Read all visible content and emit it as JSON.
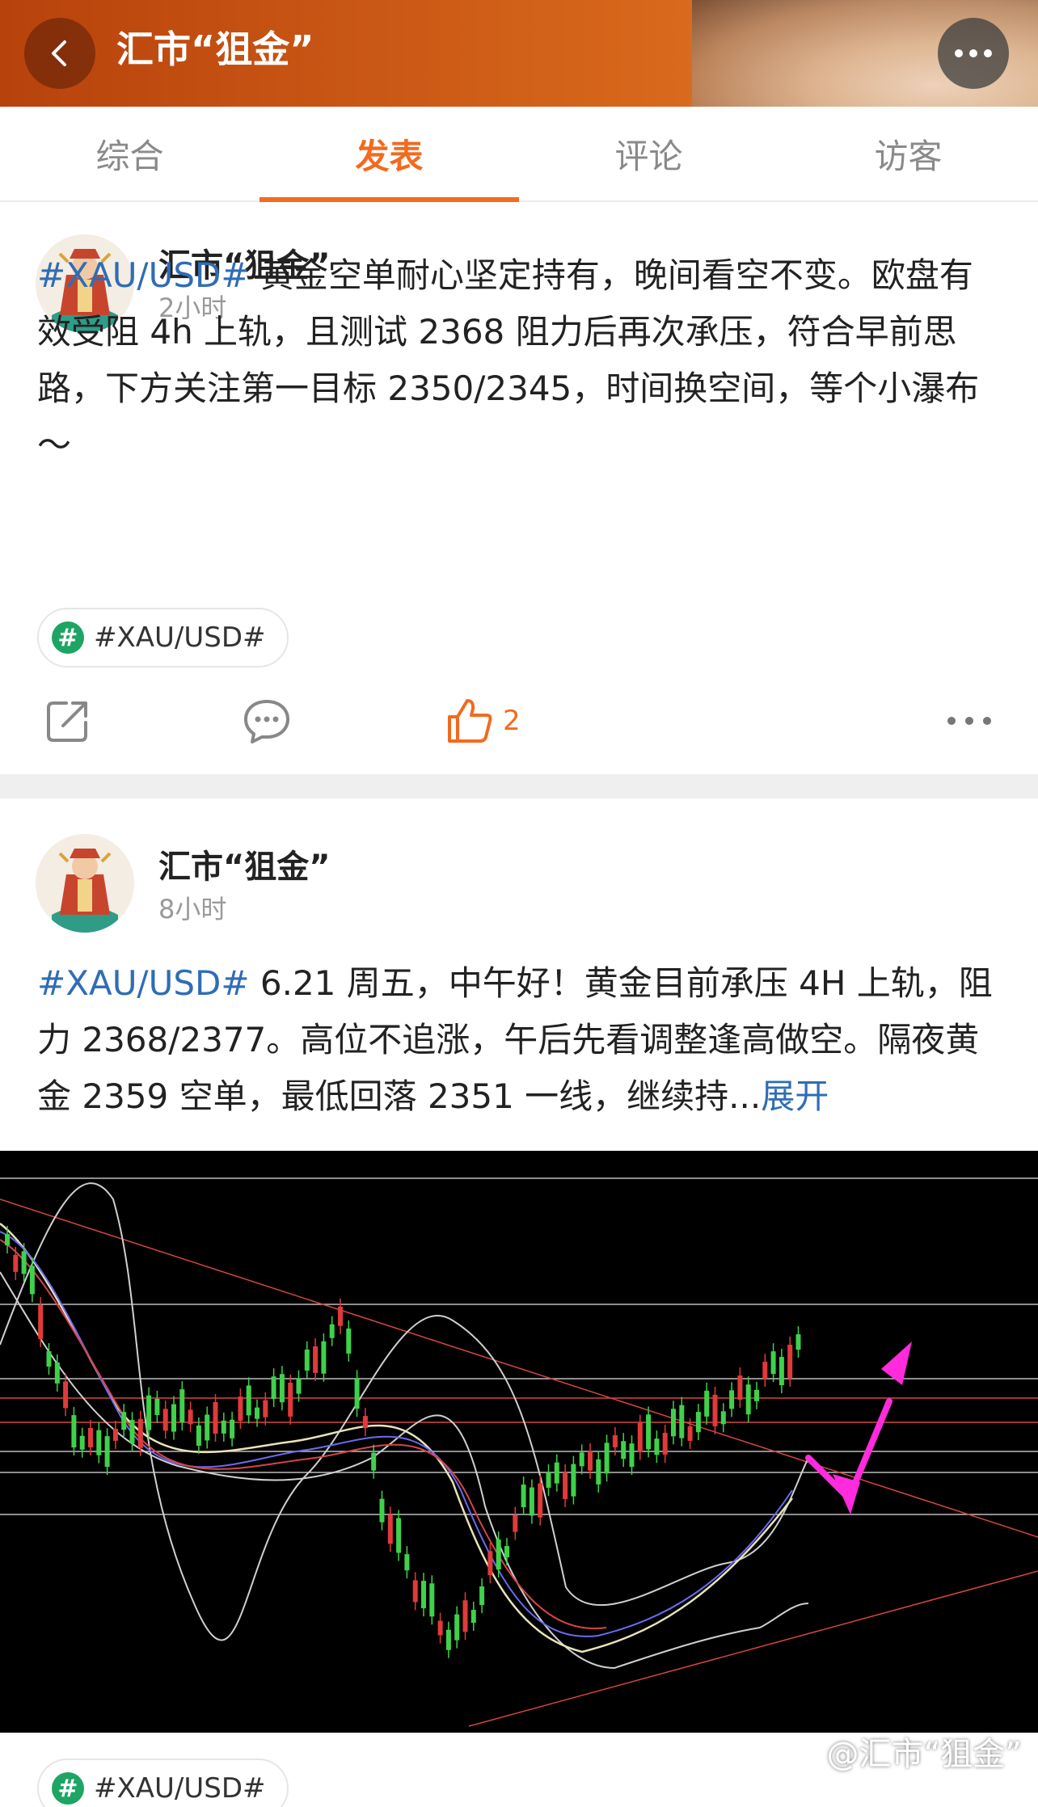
{
  "header": {
    "title": "汇市“狙金”",
    "back_icon": "chevron-left-icon",
    "more_icon": "more-horizontal-icon",
    "accent": "#f36a1e"
  },
  "tabs": [
    {
      "label": "综合",
      "active": false
    },
    {
      "label": "发表",
      "active": true
    },
    {
      "label": "评论",
      "active": false
    },
    {
      "label": "访客",
      "active": false
    }
  ],
  "posts": [
    {
      "author": "汇市“狙金”",
      "time": "2小时",
      "hashtag": "#XAU/USD#",
      "text": " 黄金空单耐心坚定持有，晚间看空不变。欧盘有效受阻 4h 上轨，且测试 2368 阻力后再次承压，符合早前思路，下方关注第一目标 2350/2345，时间换空间，等个小瀑布～",
      "topic": "#XAU/USD#",
      "like_count": "2"
    },
    {
      "author": "汇市“狙金”",
      "time": "8小时",
      "hashtag": "#XAU/USD#",
      "text": " 6.21 周五，中午好！黄金目前承压 4H 上轨，阻力 2368/2377。高位不追涨，午后先看调整逢高做空。隔夜黄金 2359 空单，最低回落 2351 一线，继续持...",
      "expand": "展开",
      "topic": "#XAU/USD#"
    }
  ],
  "watermark": "@汇市“狙金”"
}
